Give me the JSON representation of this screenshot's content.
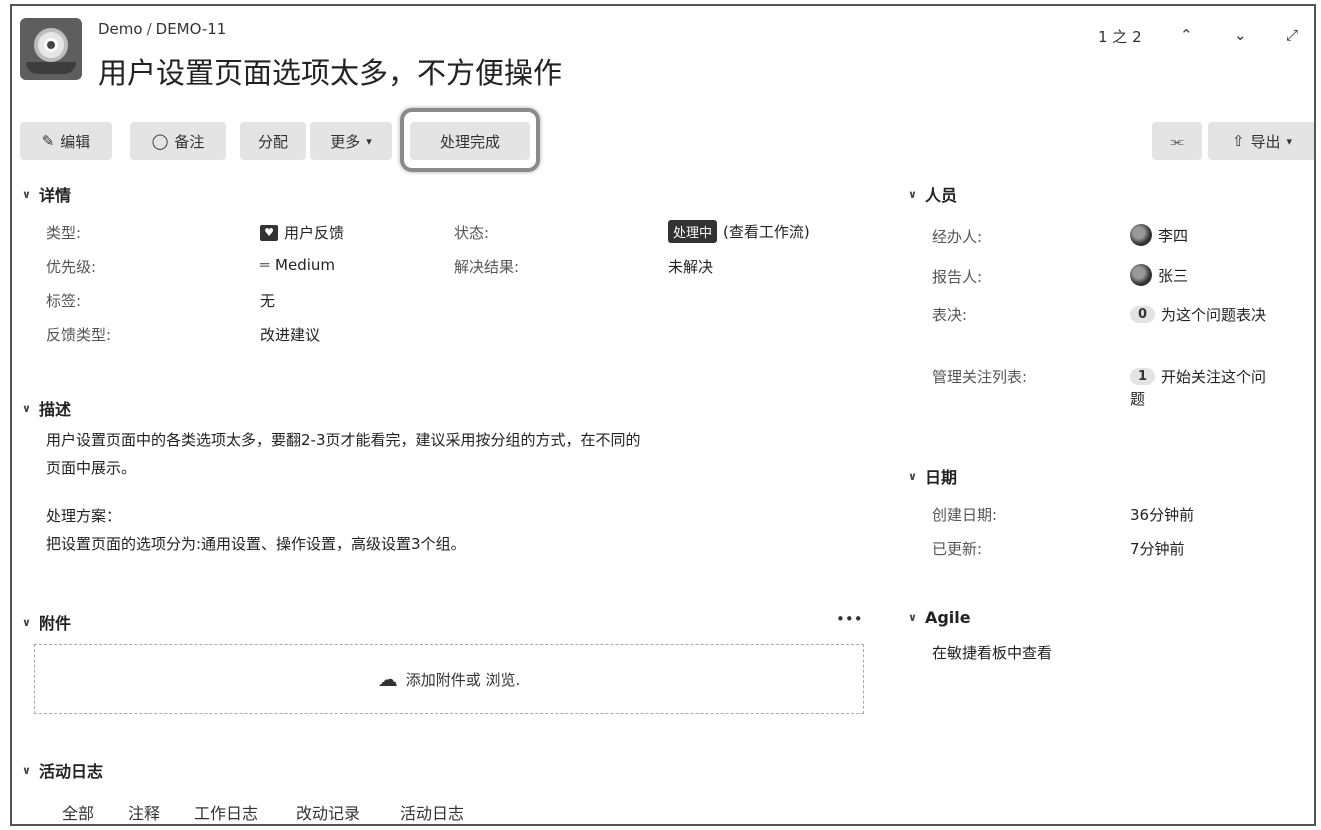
{
  "header": {
    "breadcrumb_project": "Demo",
    "breadcrumb_sep": "/",
    "breadcrumb_issue": "DEMO-11",
    "title": "用户设置页面选项太多，不方便操作",
    "pager": "1 之 2"
  },
  "toolbar": {
    "edit": "编辑",
    "comment": "备注",
    "assign": "分配",
    "more": "更多",
    "resolve": "处理完成",
    "export": "导出"
  },
  "details": {
    "heading": "详情",
    "type_label": "类型:",
    "type_value": "用户反馈",
    "priority_label": "优先级:",
    "priority_value": "Medium",
    "labels_label": "标签:",
    "labels_value": "无",
    "feedback_label": "反馈类型:",
    "feedback_value": "改进建议",
    "status_label": "状态:",
    "status_value": "处理中",
    "workflow_link": "(查看工作流)",
    "resolution_label": "解决结果:",
    "resolution_value": "未解决"
  },
  "description": {
    "heading": "描述",
    "line1": "用户设置页面中的各类选项太多，要翻2-3页才能看完，建议采用按分组的方式，在不同的",
    "line2": "页面中展示。",
    "line3": "处理方案：",
    "line4": "把设置页面的选项分为:通用设置、操作设置，高级设置3个组。"
  },
  "attachments": {
    "heading": "附件",
    "more": "•••",
    "drop_text": "添加附件或 浏览."
  },
  "activity": {
    "heading": "活动日志",
    "tabs": [
      "全部",
      "注释",
      "工作日志",
      "改动记录",
      "活动日志"
    ]
  },
  "people": {
    "heading": "人员",
    "assignee_label": "经办人:",
    "assignee_value": "李四",
    "reporter_label": "报告人:",
    "reporter_value": "张三",
    "votes_label": "表决:",
    "votes_count": "0",
    "votes_text": "为这个问题表决",
    "watchers_label": "管理关注列表:",
    "watchers_count": "1",
    "watchers_text_1": "开始关注这个问",
    "watchers_text_2": "题"
  },
  "dates": {
    "heading": "日期",
    "created_label": "创建日期:",
    "created_value": "36分钟前",
    "updated_label": "已更新:",
    "updated_value": "7分钟前"
  },
  "agile": {
    "heading": "Agile",
    "link": "在敏捷看板中查看"
  },
  "colors": {
    "status_badge": "#333333",
    "button_bg": "#e4e4e4"
  }
}
